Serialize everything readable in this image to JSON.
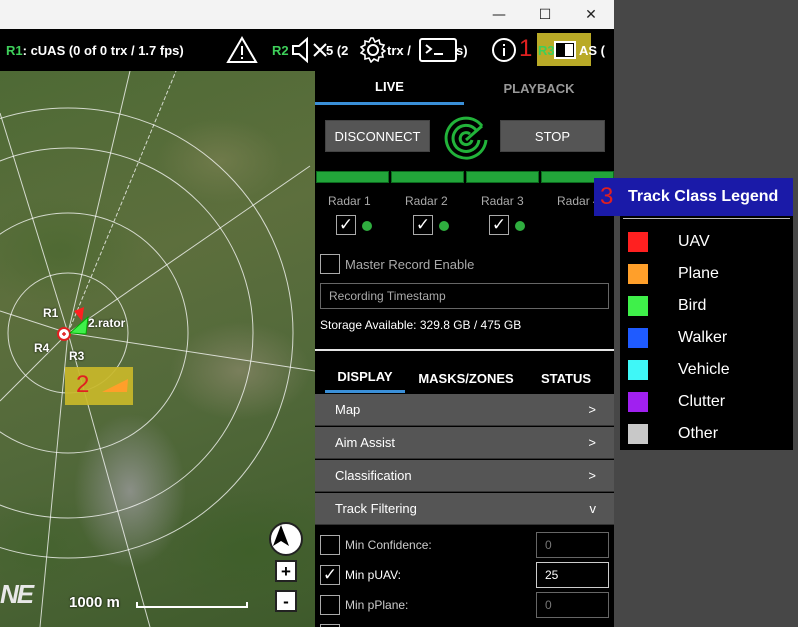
{
  "window": {
    "minimize_glyph": "—",
    "maximize_glyph": "☐",
    "close_glyph": "✕"
  },
  "statusbar": {
    "r1_id": "R1",
    "r1_text": ": cUAS  (0 of 0 trx / 1.7 fps)",
    "r2_id": "R2",
    "r2_text": "5  (2",
    "r2_text_b": "trx /",
    "r2_text_c": "s)",
    "r3_id": "R3",
    "r3_text": "AS  (",
    "icons": [
      "warning-icon",
      "mute-icon",
      "gear-icon",
      "terminal-icon",
      "info-icon"
    ]
  },
  "callouts": {
    "one": "1",
    "two": "2",
    "three": "3"
  },
  "map": {
    "labels": {
      "r1": "R1",
      "r3": "R3",
      "r4": "R4",
      "operator": "2.rator"
    },
    "scale": "1000 m",
    "zoom_in": "+",
    "zoom_out": "-",
    "logo": "NE"
  },
  "panel": {
    "tabs": [
      "LIVE",
      "PLAYBACK"
    ],
    "active_tab": "LIVE",
    "disconnect": "DISCONNECT",
    "stop": "STOP",
    "radars": [
      {
        "label": "Radar 1",
        "checked": true
      },
      {
        "label": "Radar 2",
        "checked": true
      },
      {
        "label": "Radar 3",
        "checked": true
      },
      {
        "label": "Radar 4",
        "checked": true
      }
    ],
    "master_record": "Master Record Enable",
    "recording_placeholder": "Recording Timestamp",
    "storage": "Storage Available: 329.8 GB / 475 GB",
    "subtabs": [
      "DISPLAY",
      "MASKS/ZONES",
      "STATUS"
    ],
    "accordion": [
      {
        "label": "Map",
        "chevron": ">"
      },
      {
        "label": "Aim Assist",
        "chevron": ">"
      },
      {
        "label": "Classification",
        "chevron": ">"
      },
      {
        "label": "Track Filtering",
        "chevron": "v"
      }
    ],
    "filters": [
      {
        "label": "Min Confidence:",
        "checked": false,
        "value": "0"
      },
      {
        "label": "Min pUAV:",
        "checked": true,
        "value": "25"
      },
      {
        "label": "Min pPlane:",
        "checked": false,
        "value": "0"
      }
    ]
  },
  "legend": {
    "title": "Track Class Legend",
    "items": [
      {
        "label": "UAV",
        "color": "#ff2020"
      },
      {
        "label": "Plane",
        "color": "#ff9f2a"
      },
      {
        "label": "Bird",
        "color": "#3ff04a"
      },
      {
        "label": "Walker",
        "color": "#1f5bff"
      },
      {
        "label": "Vehicle",
        "color": "#3ff7f7"
      },
      {
        "label": "Clutter",
        "color": "#a020f0"
      },
      {
        "label": "Other",
        "color": "#c8c8c8"
      }
    ]
  }
}
